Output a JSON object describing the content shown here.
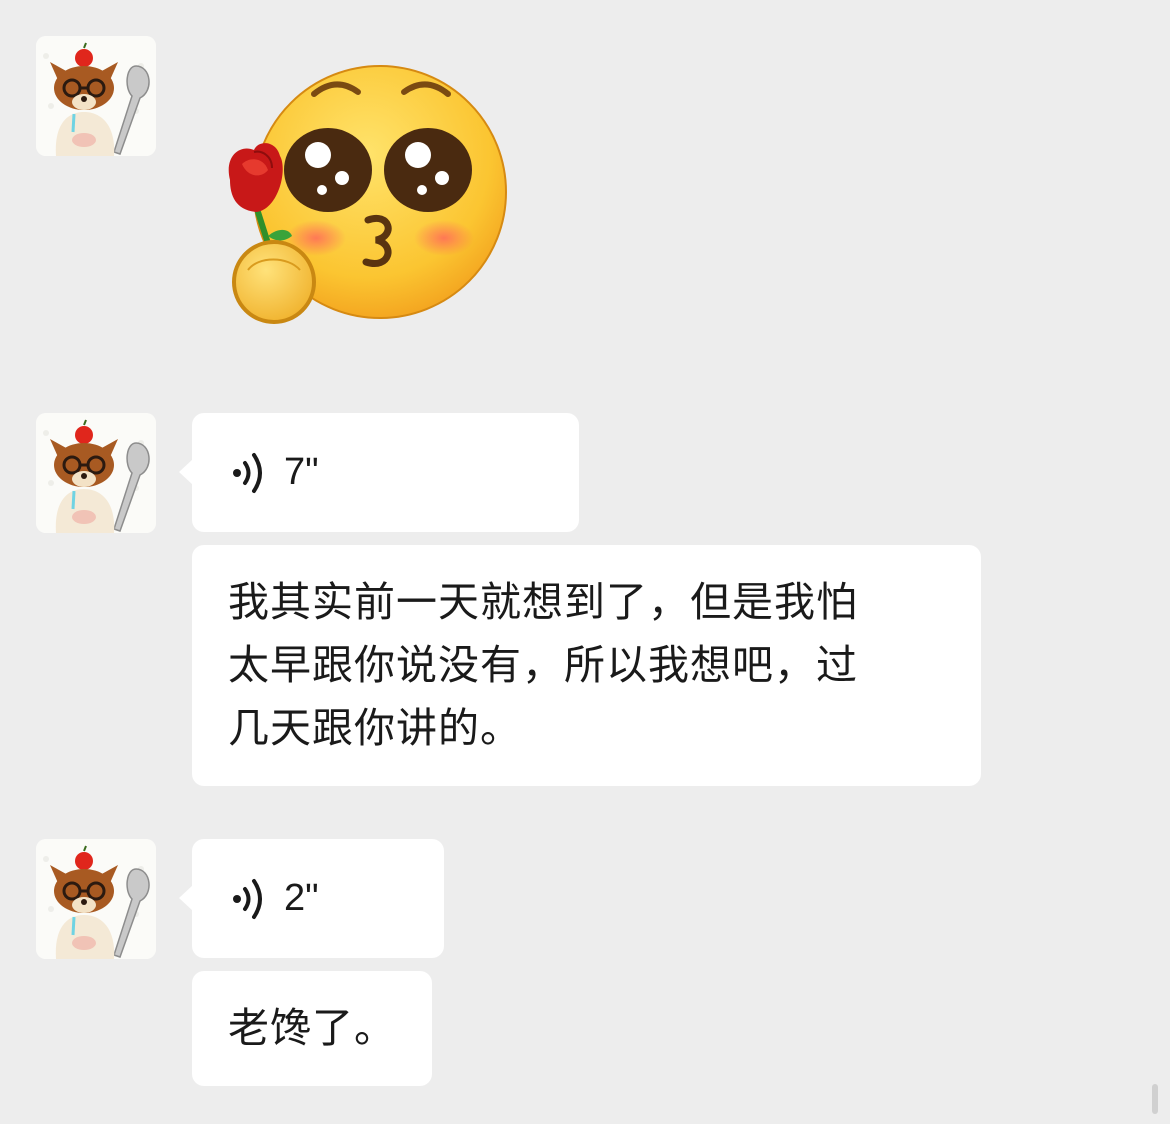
{
  "messages": [
    {
      "type": "sticker",
      "sender": "contact",
      "sticker_name": "blushing-face-with-rose-icon"
    },
    {
      "type": "voice",
      "sender": "contact",
      "duration": "7\"",
      "icon": "voice-wave-icon"
    },
    {
      "type": "text",
      "sender": "contact",
      "text": "我其实前一天就想到了，但是我怕\n太早跟你说没有，所以我想吧，过\n几天跟你讲的。"
    },
    {
      "type": "voice",
      "sender": "contact",
      "duration": "2\"",
      "icon": "voice-wave-icon"
    },
    {
      "type": "text",
      "sender": "contact",
      "text": "老馋了。"
    }
  ],
  "colors": {
    "background": "#ededed",
    "bubble": "#ffffff",
    "text": "#1a1a1a"
  }
}
